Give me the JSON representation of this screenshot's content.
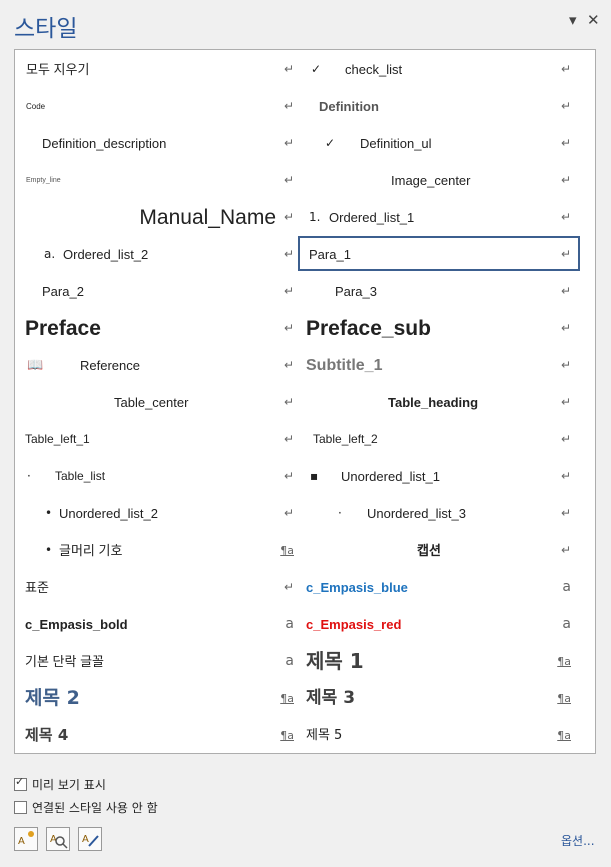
{
  "pane": {
    "title": "스타일",
    "menu_glyph": "▾",
    "close_glyph": "✕"
  },
  "styles": [
    {
      "left": {
        "label": "모두 지우기",
        "prefix": "",
        "mark": "↵"
      },
      "right": {
        "label": "check_list",
        "prefix": "✓",
        "mark": "↵"
      }
    },
    {
      "left": {
        "label": "Code",
        "prefix": "",
        "mark": "↵"
      },
      "right": {
        "label": "Definition",
        "prefix": "",
        "mark": "↵"
      }
    },
    {
      "left": {
        "label": "Definition_description",
        "prefix": "",
        "mark": "↵"
      },
      "right": {
        "label": "Definition_ul",
        "prefix": "✓",
        "mark": "↵"
      }
    },
    {
      "left": {
        "label": "Empty_line",
        "prefix": "",
        "mark": "↵"
      },
      "right": {
        "label": "Image_center",
        "prefix": "",
        "mark": "↵"
      }
    },
    {
      "left": {
        "label": "Manual_Name",
        "prefix": "",
        "mark": "↵"
      },
      "right": {
        "label": "Ordered_list_1",
        "prefix": "1.",
        "mark": "↵"
      }
    },
    {
      "left": {
        "label": "Ordered_list_2",
        "prefix": "a.",
        "mark": "↵"
      },
      "right": {
        "label": "Para_1",
        "prefix": "",
        "mark": "↵"
      }
    },
    {
      "left": {
        "label": "Para_2",
        "prefix": "",
        "mark": "↵"
      },
      "right": {
        "label": "Para_3",
        "prefix": "",
        "mark": "↵"
      }
    },
    {
      "left": {
        "label": "Preface",
        "prefix": "",
        "mark": "↵"
      },
      "right": {
        "label": "Preface_sub",
        "prefix": "",
        "mark": "↵"
      }
    },
    {
      "left": {
        "label": "Reference",
        "prefix": "📖",
        "mark": "↵"
      },
      "right": {
        "label": "Subtitle_1",
        "prefix": "",
        "mark": "↵"
      }
    },
    {
      "left": {
        "label": "Table_center",
        "prefix": "",
        "mark": "↵"
      },
      "right": {
        "label": "Table_heading",
        "prefix": "",
        "mark": "↵"
      }
    },
    {
      "left": {
        "label": "Table_left_1",
        "prefix": "",
        "mark": "↵"
      },
      "right": {
        "label": "Table_left_2",
        "prefix": "",
        "mark": "↵"
      }
    },
    {
      "left": {
        "label": "Table_list",
        "prefix": "·",
        "mark": "↵"
      },
      "right": {
        "label": "Unordered_list_1",
        "prefix": "▪",
        "mark": "↵"
      }
    },
    {
      "left": {
        "label": "Unordered_list_2",
        "prefix": "•",
        "mark": "↵"
      },
      "right": {
        "label": "Unordered_list_3",
        "prefix": "·",
        "mark": "↵"
      }
    },
    {
      "left": {
        "label": "글머리 기호",
        "prefix": "•",
        "mark": "¶a"
      },
      "right": {
        "label": "캡션",
        "prefix": "",
        "mark": "↵"
      }
    },
    {
      "left": {
        "label": "표준",
        "prefix": "",
        "mark": "↵"
      },
      "right": {
        "label": "c_Empasis_blue",
        "prefix": "",
        "mark": "a"
      }
    },
    {
      "left": {
        "label": "c_Empasis_bold",
        "prefix": "",
        "mark": "a"
      },
      "right": {
        "label": "c_Empasis_red",
        "prefix": "",
        "mark": "a"
      }
    },
    {
      "left": {
        "label": "기본 단락 글꼴",
        "prefix": "",
        "mark": "a"
      },
      "right": {
        "label": "제목 1",
        "prefix": "",
        "mark": "¶a"
      }
    },
    {
      "left": {
        "label": "제목 2",
        "prefix": "",
        "mark": "¶a"
      },
      "right": {
        "label": "제목 3",
        "prefix": "",
        "mark": "¶a"
      }
    },
    {
      "left": {
        "label": "제목 4",
        "prefix": "",
        "mark": "¶a"
      },
      "right": {
        "label": "제목 5",
        "prefix": "",
        "mark": "¶a"
      }
    }
  ],
  "selected_style": "Para_1",
  "options": {
    "show_preview": {
      "label": "미리 보기 표시",
      "checked": true
    },
    "disable_linked": {
      "label": "연결된 스타일 사용 안 함",
      "checked": false
    }
  },
  "toolbar": {
    "new_style_icon": "new-style-icon",
    "style_inspector_icon": "style-inspector-icon",
    "manage_styles_icon": "manage-styles-icon",
    "options_label": "옵션..."
  },
  "colors": {
    "accent": "#2b579a",
    "blue": "#1e73be",
    "red": "#e01010",
    "heading": "#3f5f8a"
  }
}
